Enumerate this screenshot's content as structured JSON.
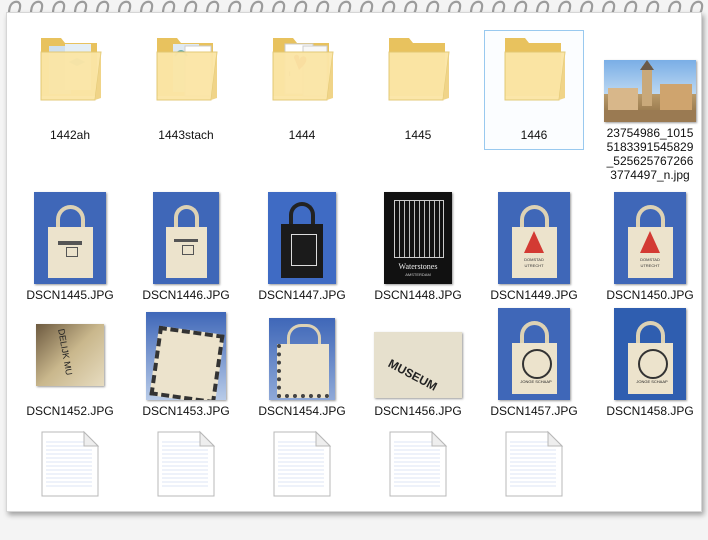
{
  "items": [
    {
      "label": "1442ah",
      "type": "folder"
    },
    {
      "label": "1443stach",
      "type": "folder"
    },
    {
      "label": "1444",
      "type": "folder"
    },
    {
      "label": "1445",
      "type": "folder"
    },
    {
      "label": "1446",
      "type": "folder",
      "selected": true
    },
    {
      "label": "23754986_1015\n5183391545829\n_525625767266\n3774497_n.jpg",
      "type": "image"
    },
    {
      "label": "DSCN1445.JPG",
      "type": "image"
    },
    {
      "label": "DSCN1446.JPG",
      "type": "image"
    },
    {
      "label": "DSCN1447.JPG",
      "type": "image"
    },
    {
      "label": "DSCN1448.JPG",
      "type": "image"
    },
    {
      "label": "DSCN1449.JPG",
      "type": "image"
    },
    {
      "label": "DSCN1450.JPG",
      "type": "image"
    },
    {
      "label": "DSCN1452.JPG",
      "type": "image"
    },
    {
      "label": "DSCN1453.JPG",
      "type": "image"
    },
    {
      "label": "DSCN1454.JPG",
      "type": "image"
    },
    {
      "label": "DSCN1456.JPG",
      "type": "image"
    },
    {
      "label": "DSCN1457.JPG",
      "type": "image"
    },
    {
      "label": "DSCN1458.JPG",
      "type": "image"
    },
    {
      "label": "",
      "type": "document"
    },
    {
      "label": "",
      "type": "document"
    },
    {
      "label": "",
      "type": "document"
    },
    {
      "label": "",
      "type": "document"
    },
    {
      "label": "",
      "type": "document"
    }
  ],
  "thumb_text": {
    "waterstones": "Waterstones",
    "waterstones_sub": "AMSTERDAM",
    "domstad": "DOMSTAD",
    "utrecht": "UTRECHT",
    "museum": "MUSEUM",
    "rijksmuseum_side": "DELIJK MU",
    "jonge_schaap": "JONGE SCHAAP"
  },
  "colors": {
    "folder_light": "#fbe6a6",
    "folder_dark": "#e8c25e",
    "selection_border": "#99c9ef",
    "sky_blue": "#3f67b8",
    "bag_canvas": "#ece3cc",
    "accent_red": "#d33a33"
  }
}
